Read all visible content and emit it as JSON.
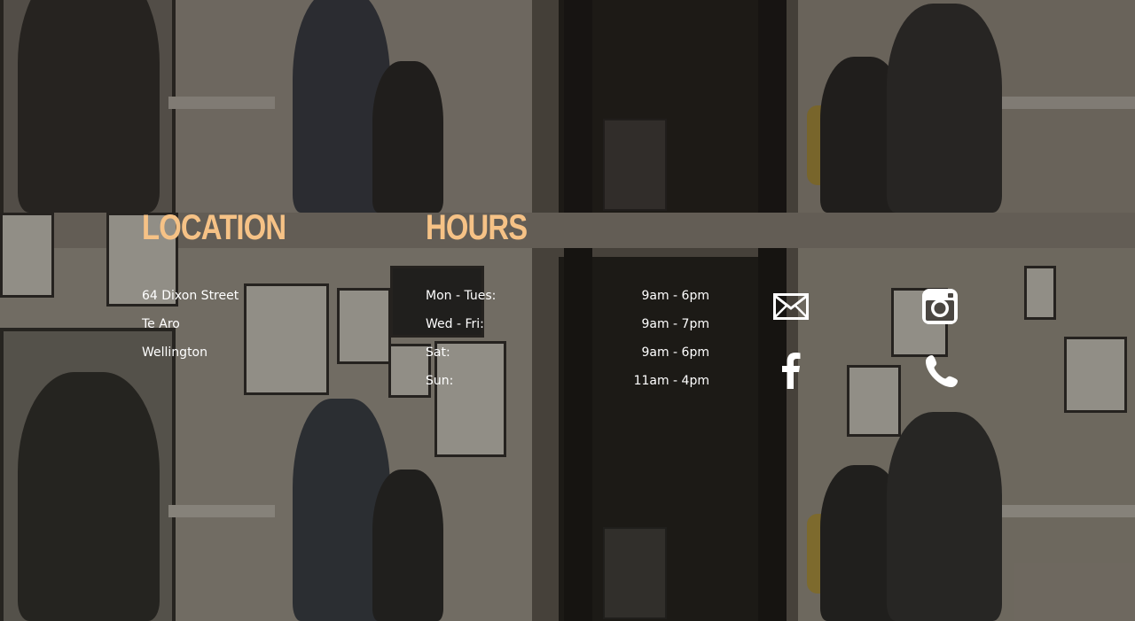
{
  "location": {
    "heading": "LOCATION",
    "address_lines": [
      "64 Dixon Street",
      "Te Aro",
      "Wellington"
    ]
  },
  "hours": {
    "heading": "HOURS",
    "rows": [
      {
        "day": "Mon - Tues:",
        "time": "9am - 6pm"
      },
      {
        "day": "Wed - Fri:",
        "time": "9am - 7pm"
      },
      {
        "day": "Sat:",
        "time": "9am - 6pm"
      },
      {
        "day": "Sun:",
        "time": "11am - 4pm"
      }
    ]
  },
  "social_icons": [
    "email-icon",
    "instagram-icon",
    "facebook-icon",
    "phone-icon"
  ],
  "colors": {
    "heading": "#f6c286",
    "text": "#ffffff",
    "icon": "#ffffff"
  }
}
